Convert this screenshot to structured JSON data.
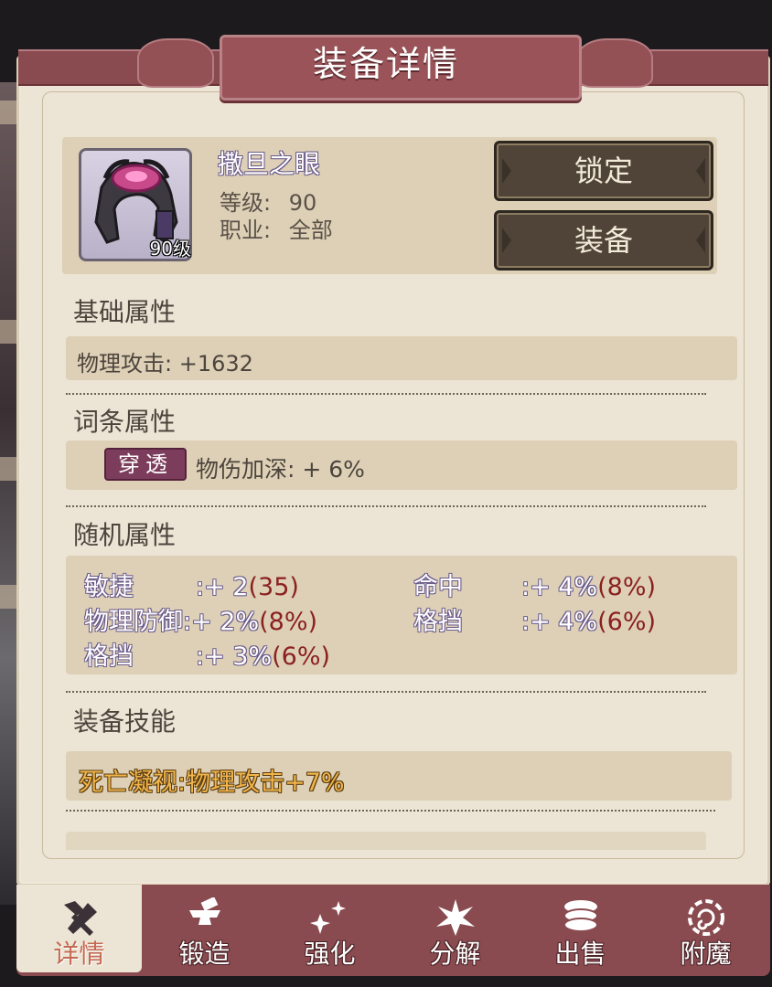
{
  "window": {
    "title": "装备详情"
  },
  "item": {
    "name": "撒旦之眼",
    "level_badge": "90级",
    "level_label": "等级:",
    "level_value": "90",
    "class_label": "职业:",
    "class_value": "全部"
  },
  "buttons": {
    "lock": "锁定",
    "equip": "装备"
  },
  "basic": {
    "title": "基础属性",
    "line": "物理攻击: +1632"
  },
  "affix": {
    "title": "词条属性",
    "tag": "穿透",
    "line": "物伤加深: + 6%"
  },
  "random": {
    "title": "随机属性",
    "stats": [
      {
        "name": "敏捷",
        "sep": ":+ 2",
        "max": "(35)"
      },
      {
        "name": "命中",
        "sep": ":+ 4%",
        "max": "(8%)"
      },
      {
        "name": "物理防御",
        "sep": ":+ 2%",
        "max": "(8%)"
      },
      {
        "name": "格挡",
        "sep": ":+ 4%",
        "max": "(6%)"
      },
      {
        "name": "格挡",
        "sep": ":+ 3%",
        "max": "(6%)"
      }
    ]
  },
  "skill": {
    "title": "装备技能",
    "line": "死亡凝视:物理攻击+7%"
  },
  "tabs": [
    {
      "label": "详情",
      "icon": "hammer-icon",
      "active": true
    },
    {
      "label": "锻造",
      "icon": "anvil-icon",
      "active": false
    },
    {
      "label": "强化",
      "icon": "sparkle-icon",
      "active": false
    },
    {
      "label": "分解",
      "icon": "burst-icon",
      "active": false
    },
    {
      "label": "出售",
      "icon": "coins-icon",
      "active": false
    },
    {
      "label": "附魔",
      "icon": "swirl-icon",
      "active": false
    }
  ],
  "colors": {
    "ribbon": "#8a4b50",
    "panel": "#ece4d4",
    "bar": "#ddd0b6",
    "button": "#4f4437",
    "max_value": "#8b2020",
    "skill": "#f0b54a"
  }
}
